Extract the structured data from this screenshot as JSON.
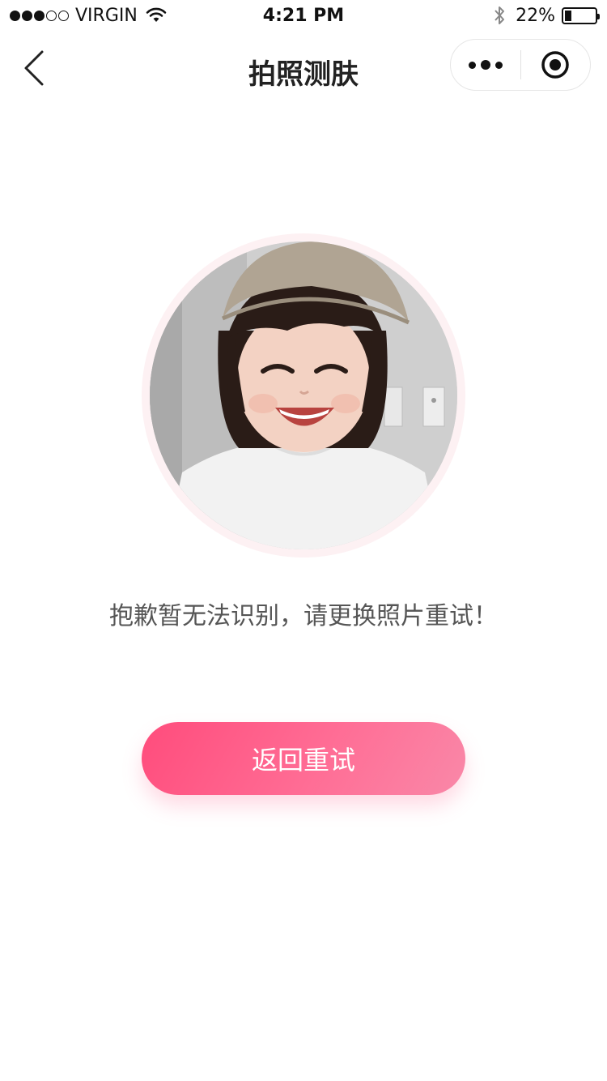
{
  "status_bar": {
    "carrier": "VIRGIN",
    "time": "4:21 PM",
    "battery_percent": "22%",
    "battery_level": 0.22,
    "signal_bars_filled": 3,
    "signal_bars_total": 5,
    "icons": [
      "signal-dots-icon",
      "wifi-icon",
      "bluetooth-icon",
      "battery-icon"
    ]
  },
  "nav": {
    "title": "拍照测肤",
    "back_icon": "chevron-left-icon",
    "more_icon": "more-dots-icon",
    "close_icon": "target-circle-icon"
  },
  "main": {
    "photo_alt": "smiling child wearing beige beret",
    "message": "抱歉暂无法识别，请更换照片重试！",
    "retry_button_label": "返回重试"
  },
  "colors": {
    "button_gradient_start": "#ff4c7c",
    "button_gradient_end": "#f988a8",
    "ring": "#fdf1f3",
    "message_text": "#555555"
  }
}
